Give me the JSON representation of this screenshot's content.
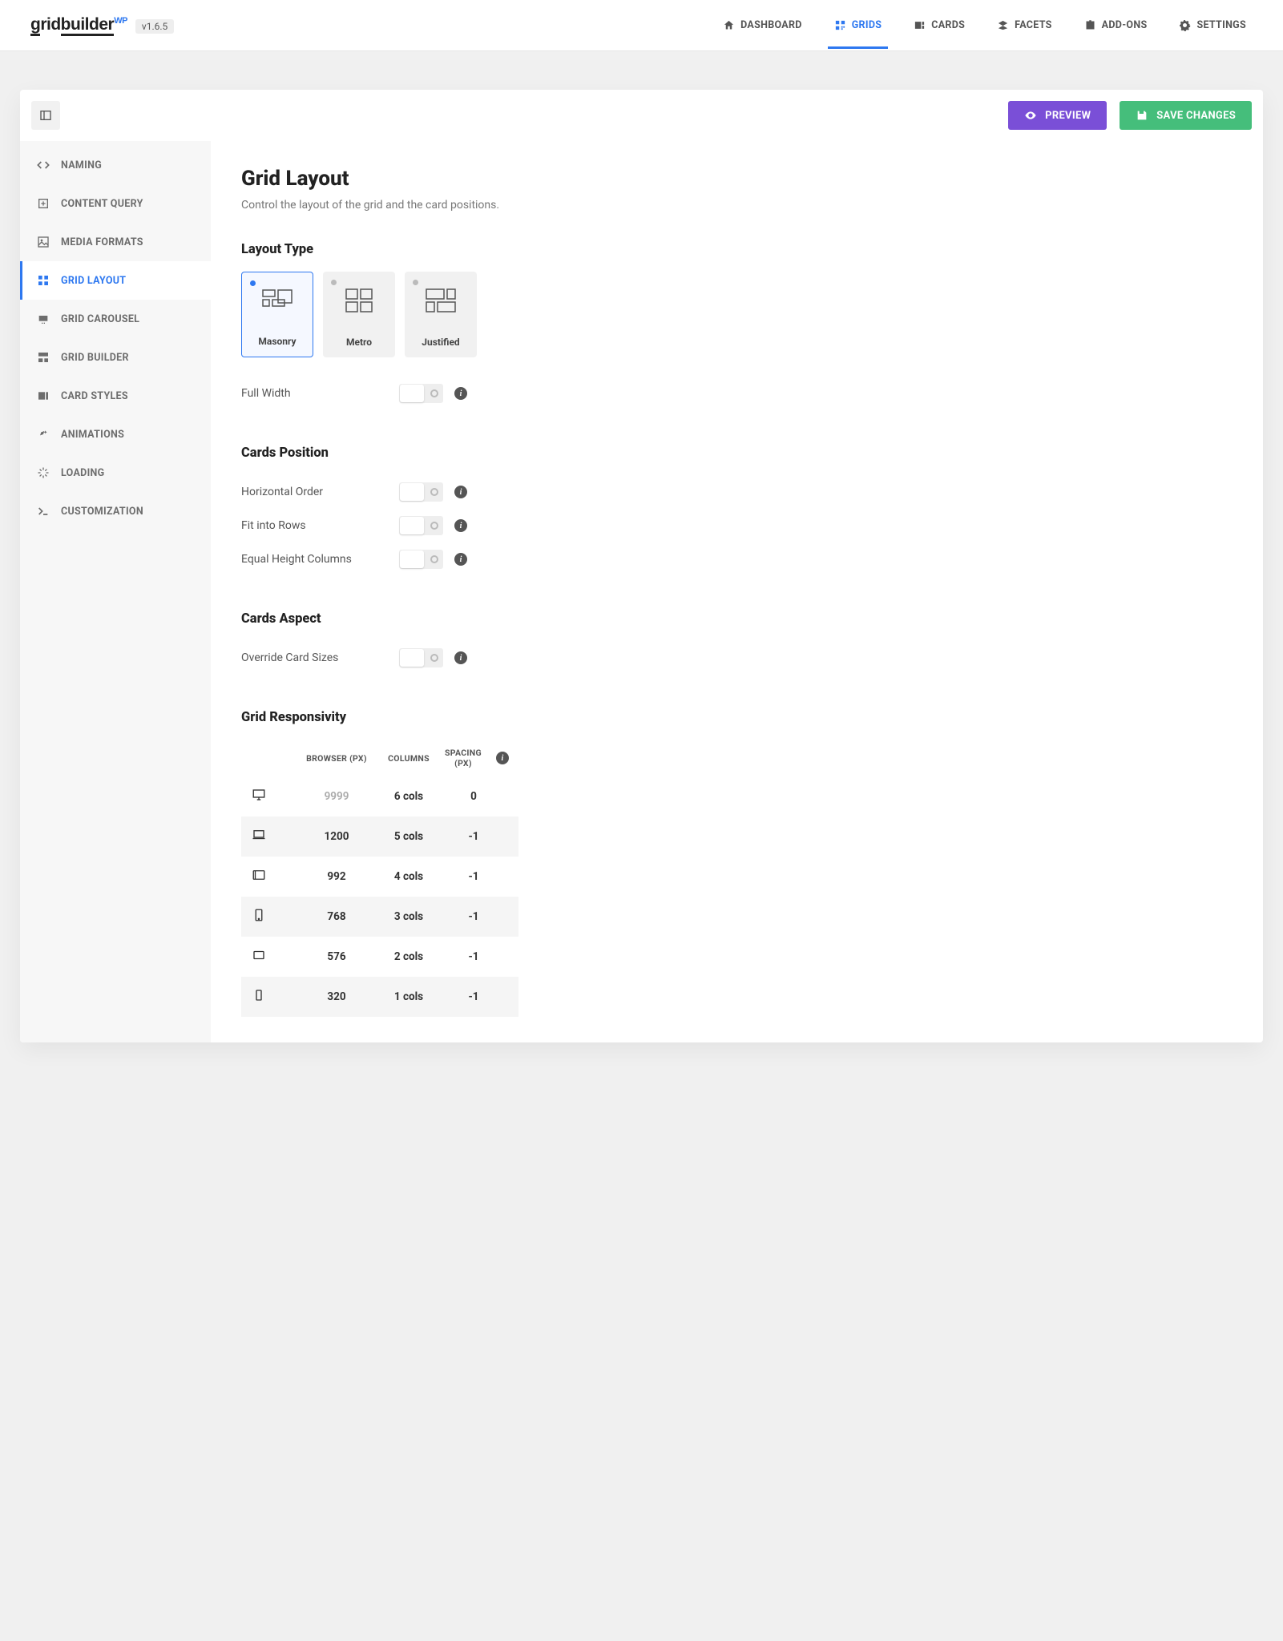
{
  "brand": {
    "name_g": "g",
    "name_rid": "rid",
    "name_builder": "builder",
    "sup": "WP",
    "version": "v1.6.5"
  },
  "nav": {
    "items": [
      {
        "label": "DASHBOARD"
      },
      {
        "label": "GRIDS"
      },
      {
        "label": "CARDS"
      },
      {
        "label": "FACETS"
      },
      {
        "label": "ADD-ONS"
      },
      {
        "label": "SETTINGS"
      }
    ]
  },
  "toolbar": {
    "preview": "PREVIEW",
    "save": "SAVE CHANGES"
  },
  "sidebar": {
    "items": [
      {
        "label": "NAMING"
      },
      {
        "label": "CONTENT QUERY"
      },
      {
        "label": "MEDIA FORMATS"
      },
      {
        "label": "GRID LAYOUT"
      },
      {
        "label": "GRID CAROUSEL"
      },
      {
        "label": "GRID BUILDER"
      },
      {
        "label": "CARD STYLES"
      },
      {
        "label": "ANIMATIONS"
      },
      {
        "label": "LOADING"
      },
      {
        "label": "CUSTOMIZATION"
      }
    ]
  },
  "page": {
    "title": "Grid Layout",
    "subtitle": "Control the layout of the grid and the card positions."
  },
  "section_layout_type": {
    "heading": "Layout Type",
    "tiles": [
      {
        "label": "Masonry"
      },
      {
        "label": "Metro"
      },
      {
        "label": "Justified"
      }
    ],
    "full_width_label": "Full Width"
  },
  "section_cards_position": {
    "heading": "Cards Position",
    "rows": [
      {
        "label": "Horizontal Order"
      },
      {
        "label": "Fit into Rows"
      },
      {
        "label": "Equal Height Columns"
      }
    ]
  },
  "section_cards_aspect": {
    "heading": "Cards Aspect",
    "rows": [
      {
        "label": "Override Card Sizes"
      }
    ]
  },
  "section_responsivity": {
    "heading": "Grid Responsivity",
    "columns": {
      "browser": "BROWSER (PX)",
      "cols": "COLUMNS",
      "spacing": "SPACING (PX)"
    },
    "rows": [
      {
        "browser": "9999",
        "cols": "6 cols",
        "spacing": "0",
        "muted": true
      },
      {
        "browser": "1200",
        "cols": "5 cols",
        "spacing": "-1"
      },
      {
        "browser": "992",
        "cols": "4 cols",
        "spacing": "-1"
      },
      {
        "browser": "768",
        "cols": "3 cols",
        "spacing": "-1"
      },
      {
        "browser": "576",
        "cols": "2 cols",
        "spacing": "-1"
      },
      {
        "browser": "320",
        "cols": "1 cols",
        "spacing": "-1"
      }
    ]
  }
}
